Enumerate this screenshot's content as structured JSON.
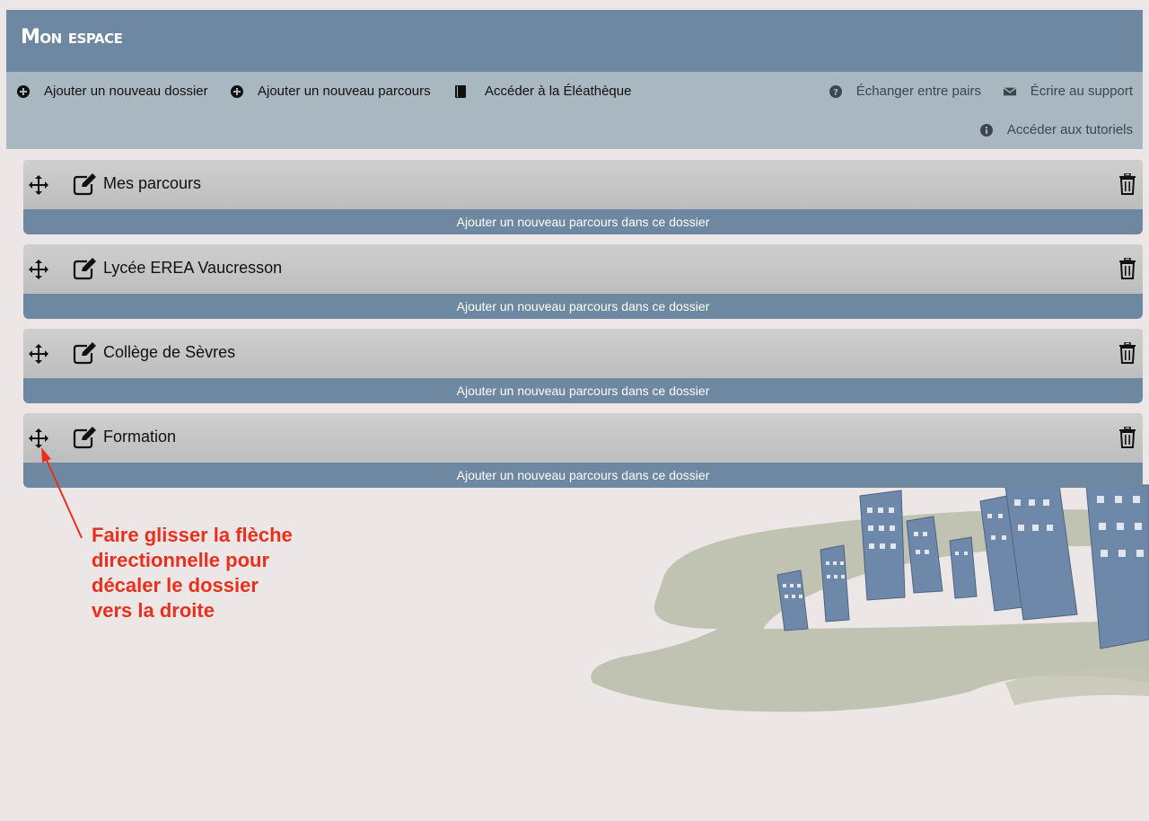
{
  "header": {
    "title": "Mon espace"
  },
  "toolbar": {
    "add_folder": "Ajouter un nouveau dossier",
    "add_course": "Ajouter un nouveau parcours",
    "library": "Accéder à la Éléathèque",
    "peers": "Échanger entre pairs",
    "support": "Écrire au support",
    "tutorials": "Accéder aux tutoriels"
  },
  "folders": [
    {
      "name": "Mes parcours",
      "add_label": "Ajouter un nouveau parcours dans ce dossier"
    },
    {
      "name": "Lycée EREA Vaucresson",
      "add_label": "Ajouter un nouveau parcours dans ce dossier"
    },
    {
      "name": "Collège de Sèvres",
      "add_label": "Ajouter un nouveau parcours dans ce dossier"
    },
    {
      "name": "Formation",
      "add_label": "Ajouter un nouveau parcours dans ce dossier"
    }
  ],
  "annotation": {
    "text": "Faire glisser la flèche directionnelle pour décaler le dossier vers la droite"
  },
  "colors": {
    "header": "#6d88a0",
    "toolbar": "#a9b7c0",
    "folder_head": "#c4c4c4",
    "folder_foot": "#6d88a0",
    "annotation": "#e8301c",
    "background": "#ece6e6"
  },
  "icons": {
    "add": "plus-circle-icon",
    "library": "book-icon",
    "peers": "question-circle-icon",
    "support": "envelope-icon",
    "tutorials": "info-circle-icon",
    "move": "move-arrows-icon",
    "edit": "edit-icon",
    "delete": "trash-icon"
  }
}
